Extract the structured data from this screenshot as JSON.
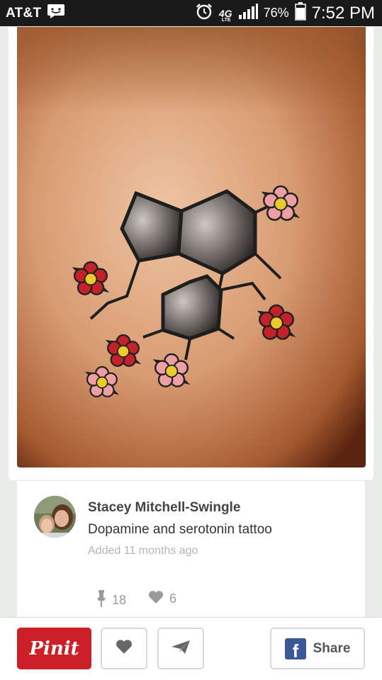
{
  "status_bar": {
    "carrier": "AT&T",
    "network": "4G",
    "network_sub": "LTE",
    "battery": "76%",
    "time": "7:52 PM"
  },
  "pin": {
    "image_alt": "serotonin-dopamine molecule tattoo with flowers",
    "pinner_name": "Stacey Mitchell-Swingle",
    "description": "Dopamine and serotonin tattoo",
    "added": "Added 11 months ago",
    "repin_count": "18",
    "like_count": "6"
  },
  "actions": {
    "pin_it": "Pinit",
    "share": "Share"
  },
  "icons": {
    "message": "message-icon",
    "alarm": "alarm-icon",
    "signal": "signal-icon",
    "battery": "battery-icon",
    "pin": "pin-icon",
    "heart": "heart-icon",
    "send": "send-icon",
    "facebook": "facebook-icon"
  },
  "colors": {
    "pinit_red": "#cb2027",
    "facebook_blue": "#3b5998",
    "status_bar": "#1a1a1a"
  }
}
